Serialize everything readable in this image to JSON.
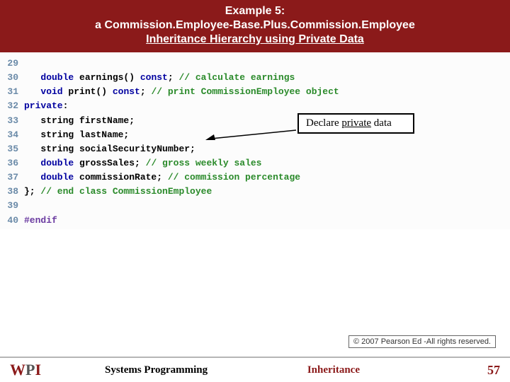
{
  "header": {
    "line1": "Example 5:",
    "line2": "a Commission.Employee-Base.Plus.Commission.Employee",
    "line3": "Inheritance Hierarchy using Private Data"
  },
  "code": {
    "l29": "29",
    "l30n": "30",
    "l30a": "double",
    "l30b": " earnings() ",
    "l30c": "const",
    "l30d": "; ",
    "l30e": "// calculate earnings",
    "l31n": "31",
    "l31a": "void",
    "l31b": " print() ",
    "l31c": "const",
    "l31d": "; ",
    "l31e": "// print CommissionEmployee object",
    "l32n": "32",
    "l32a": "private",
    "l32b": ":",
    "l33n": "33",
    "l33a": "string ",
    "l33b": "firstName;",
    "l34n": "34",
    "l34a": "string ",
    "l34b": "lastName;",
    "l35n": "35",
    "l35a": "string ",
    "l35b": "socialSecurityNumber;",
    "l36n": "36",
    "l36a": "double",
    "l36b": " grossSales; ",
    "l36c": "// gross weekly sales",
    "l37n": "37",
    "l37a": "double",
    "l37b": " commissionRate; ",
    "l37c": "// commission percentage",
    "l38n": "38",
    "l38a": "}; ",
    "l38b": "// end class CommissionEmployee",
    "l39n": "39",
    "l40n": "40",
    "l40a": "#endif"
  },
  "callout": {
    "prefix": "Declare ",
    "priv": "private",
    "suffix": " data"
  },
  "copyright": "© 2007 Pearson Ed -All rights reserved.",
  "footer": {
    "logo_w": "W",
    "logo_p": "P",
    "logo_i": "I",
    "center": "Systems Programming",
    "topic": "Inheritance",
    "page": "57"
  }
}
